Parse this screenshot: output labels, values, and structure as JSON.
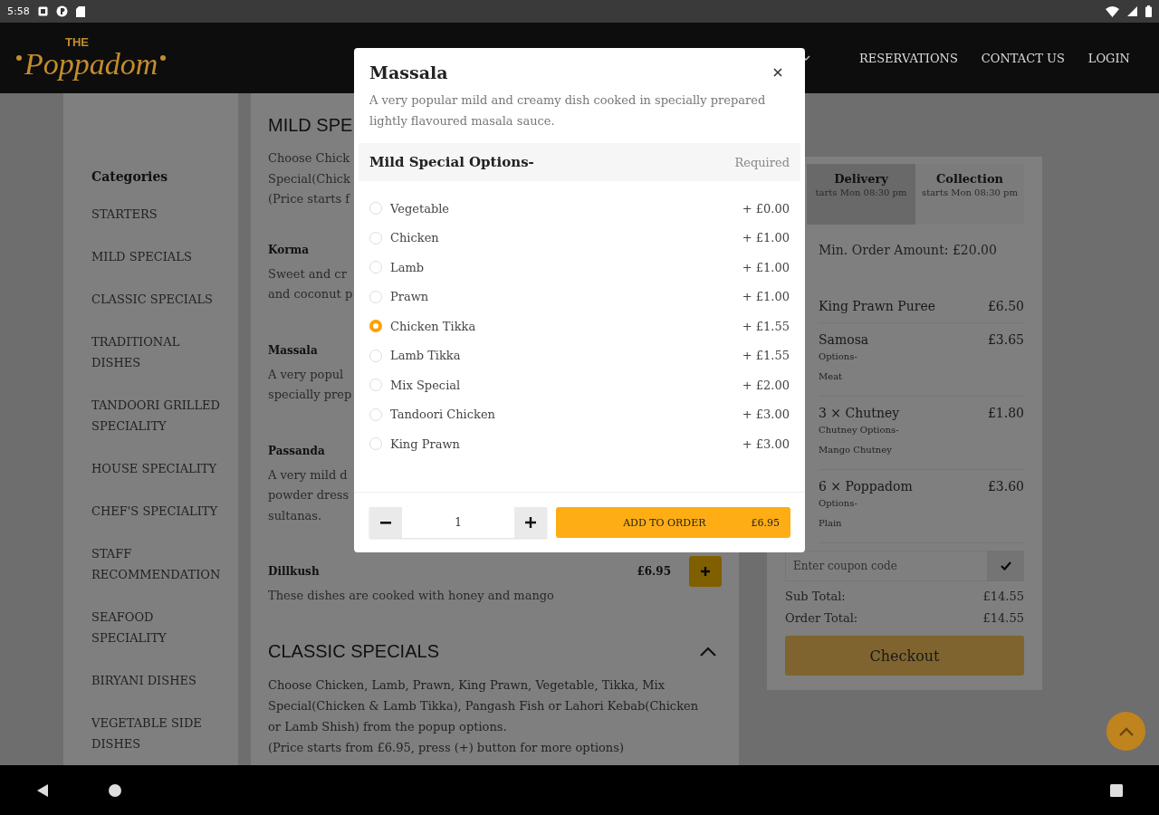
{
  "status_bar": {
    "time": "5:58"
  },
  "header": {
    "logo": {
      "small": "THE",
      "name": "Poppadom"
    },
    "nav": [
      {
        "label": "RESERVATIONS"
      },
      {
        "label": "CONTACT US"
      },
      {
        "label": "LOGIN"
      }
    ]
  },
  "sidebar": {
    "title": "Categories",
    "items": [
      {
        "label": "STARTERS"
      },
      {
        "label": "MILD SPECIALS"
      },
      {
        "label": "CLASSIC SPECIALS"
      },
      {
        "label": "TRADITIONAL DISHES"
      },
      {
        "label": "TANDOORI GRILLED SPECIALITY"
      },
      {
        "label": "HOUSE SPECIALITY"
      },
      {
        "label": "CHEF'S SPECIALITY"
      },
      {
        "label": "STAFF RECOMMENDATION"
      },
      {
        "label": "SEAFOOD SPECIALITY"
      },
      {
        "label": "BIRYANI DISHES"
      },
      {
        "label": "VEGETABLE SIDE DISHES"
      }
    ]
  },
  "menu": {
    "sections": [
      {
        "title": "MILD SPE",
        "description": [
          "Choose Chick",
          "Special(Chick",
          "(Price starts f"
        ],
        "dishes": [
          {
            "name": "Korma",
            "description": [
              "Sweet and cr",
              "and coconut p"
            ]
          },
          {
            "name": "Massala",
            "description": [
              "A very popul",
              "specially prep"
            ]
          },
          {
            "name": "Passanda",
            "description": [
              "A very mild d",
              "powder dress",
              "sultanas."
            ]
          },
          {
            "name": "Dillkush",
            "price": "£6.95",
            "description": [
              "These dishes are cooked with honey and mango"
            ]
          }
        ]
      },
      {
        "title": "CLASSIC SPECIALS",
        "expanded": true,
        "paragraphs": [
          "Choose Chicken, Lamb, Prawn, King Prawn, Vegetable, Tikka, Mix Special(Chicken & Lamb Tikka), Pangash Fish or Lahori Kebab(Chicken or Lamb Shish) from the popup options.",
          "(Price starts from £6.95, press (+) button for more options)"
        ]
      }
    ]
  },
  "cart": {
    "tabs": [
      {
        "label": "Delivery",
        "sub": "tarts Mon 08:30 pm",
        "selected": true
      },
      {
        "label": "Collection",
        "sub": "starts Mon 08:30 pm",
        "selected": false
      }
    ],
    "min_order": "Min. Order Amount: £20.00",
    "items": [
      {
        "name": "King Prawn Puree",
        "price": "£6.50"
      },
      {
        "name": "Samosa",
        "price": "£3.65",
        "option_label": "Options-",
        "option_value": "Meat"
      },
      {
        "name": "3 × Chutney",
        "price": "£1.80",
        "option_label": "Chutney Options-",
        "option_value": "Mango Chutney"
      },
      {
        "name": "6 × Poppadom",
        "price": "£3.60",
        "option_label": "Options-",
        "option_value": "Plain"
      }
    ],
    "coupon": {
      "placeholder": "Enter coupon code"
    },
    "totals": [
      {
        "label": "Sub Total:",
        "value": "£14.55"
      },
      {
        "label": "Order Total:",
        "value": "£14.55"
      }
    ],
    "checkout": "Checkout"
  },
  "modal": {
    "title": "Massala",
    "description": "A very popular mild and creamy dish cooked in specially prepared lightly flavoured masala sauce.",
    "group": {
      "title": "Mild Special Options-",
      "note": "Required"
    },
    "options": [
      {
        "label": "Vegetable",
        "price": "+ £0.00",
        "selected": false
      },
      {
        "label": "Chicken",
        "price": "+ £1.00",
        "selected": false
      },
      {
        "label": "Lamb",
        "price": "+ £1.00",
        "selected": false
      },
      {
        "label": "Prawn",
        "price": "+ £1.00",
        "selected": false
      },
      {
        "label": "Chicken Tikka",
        "price": "+ £1.55",
        "selected": true
      },
      {
        "label": "Lamb Tikka",
        "price": "+ £1.55",
        "selected": false
      },
      {
        "label": "Mix Special",
        "price": "+ £2.00",
        "selected": false
      },
      {
        "label": "Tandoori Chicken",
        "price": "+ £3.00",
        "selected": false
      },
      {
        "label": "King Prawn",
        "price": "+ £3.00",
        "selected": false
      }
    ],
    "quantity": "1",
    "add_button": {
      "label": "ADD TO ORDER",
      "price": "£6.95"
    }
  }
}
